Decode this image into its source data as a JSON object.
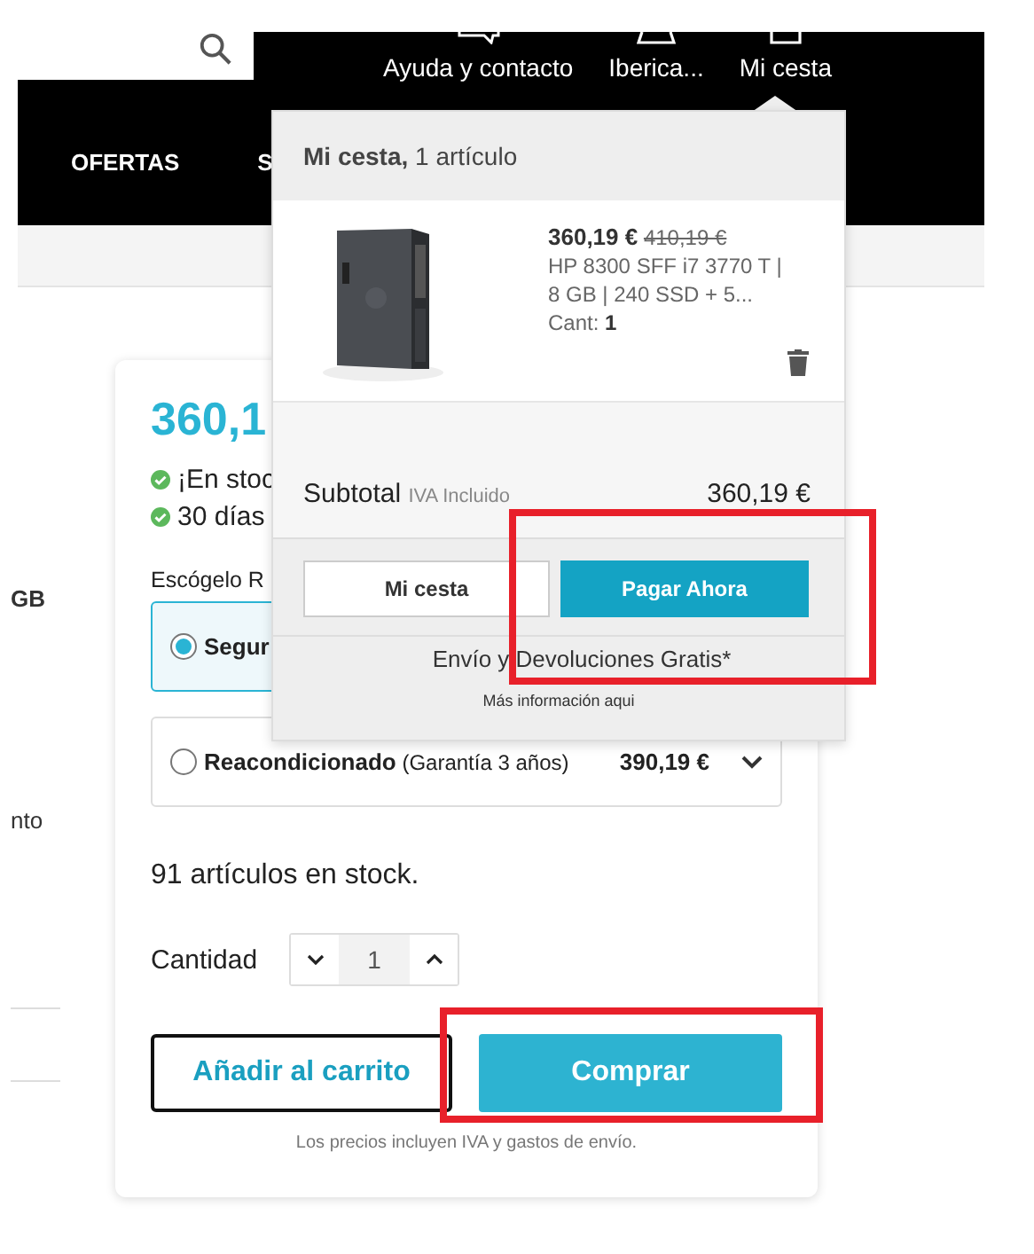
{
  "header": {
    "links": [
      "Ayuda y contacto",
      "Iberica...",
      "Mi cesta"
    ],
    "nav": [
      "OFERTAS",
      "S"
    ]
  },
  "side_fragments": [
    "GB",
    "nto"
  ],
  "product": {
    "price": "360,1",
    "notes": [
      "¡En stoc",
      "30 días"
    ],
    "choose_label": "Escógelo R",
    "options": [
      {
        "name": "Segur",
        "selected": true
      },
      {
        "name": "Reacondicionado",
        "detail": "(Garantía 3 años)",
        "price": "390,19 €",
        "selected": false
      }
    ],
    "stock": "91 artículos en stock.",
    "quantity_label": "Cantidad",
    "quantity": "1",
    "add_to_cart": "Añadir al carrito",
    "buy": "Comprar",
    "footnote": "Los precios incluyen IVA y gastos de envío."
  },
  "cart": {
    "title": "Mi cesta,",
    "count": "1 artículo",
    "item": {
      "price": "360,19 €",
      "old_price": "410,19 €",
      "name": [
        "HP 8300 SFF i7 3770 T |",
        "8 GB | 240 SSD + 5..."
      ],
      "qty_label": "Cant:",
      "qty": "1"
    },
    "subtotal_label": "Subtotal",
    "tax_note": "IVA Incluido",
    "subtotal": "360,19 €",
    "buttons": [
      "Mi cesta",
      "Pagar Ahora"
    ],
    "shipping": "Envío y Devoluciones Gratis*",
    "more_info": "Más información aqui"
  }
}
